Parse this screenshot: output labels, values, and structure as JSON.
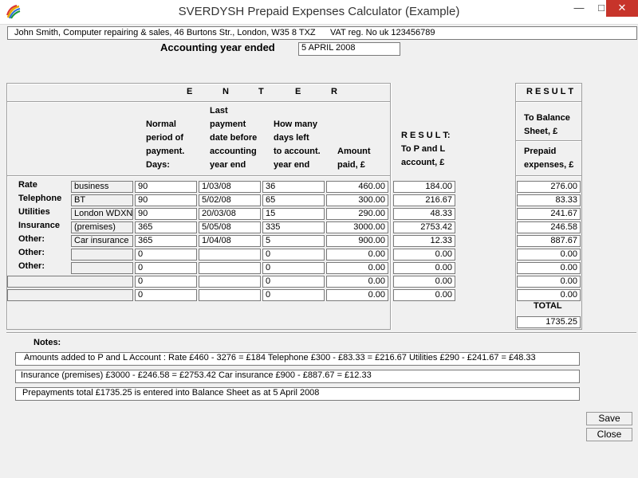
{
  "window": {
    "title": "SVERDYSH Prepaid Expenses Calculator (Example)",
    "minimize": "—",
    "maximize": "□",
    "close": "✕"
  },
  "company": {
    "line": "John Smith, Computer repairing & sales, 46 Burtons Str., London, W35 8 TXZ",
    "vat": "VAT reg. No uk 123456789"
  },
  "accounting": {
    "label": "Accounting year ended",
    "value": "5 APRIL 2008"
  },
  "enter_header": [
    "E",
    "N",
    "T",
    "E",
    "R"
  ],
  "columns": {
    "normal": [
      "Normal",
      "period of",
      "payment.",
      "Days:"
    ],
    "last": [
      "Last",
      "payment",
      "date before",
      "accounting",
      "year end"
    ],
    "howmany": [
      "How many",
      "days left",
      "to account.",
      "year end"
    ],
    "amount": [
      "Amount",
      "paid, £"
    ],
    "pl": [
      "R E S U L T:",
      "To P and L",
      "account, £"
    ]
  },
  "result_panel": {
    "title": "R E S U L T",
    "balance": [
      "To Balance",
      "Sheet, £"
    ],
    "prepaid": [
      "Prepaid",
      "expenses, £"
    ],
    "total_label": "TOTAL",
    "total_value": "1735.25"
  },
  "rows": [
    {
      "label": "Rate",
      "desc": "business",
      "days": "90",
      "date": "1/03/08",
      "left": "36",
      "amount": "460.00",
      "pl": "184.00",
      "bs": "276.00"
    },
    {
      "label": "Telephone",
      "desc": "BT",
      "days": "90",
      "date": "5/02/08",
      "left": "65",
      "amount": "300.00",
      "pl": "216.67",
      "bs": "83.33"
    },
    {
      "label": "Utilities",
      "desc": "London WDXN",
      "days": "90",
      "date": "20/03/08",
      "left": "15",
      "amount": "290.00",
      "pl": "48.33",
      "bs": "241.67"
    },
    {
      "label": "Insurance",
      "desc": "(premises)",
      "days": "365",
      "date": "5/05/08",
      "left": "335",
      "amount": "3000.00",
      "pl": "2753.42",
      "bs": "246.58"
    },
    {
      "label": "Other:",
      "desc": "Car insurance",
      "days": "365",
      "date": "1/04/08",
      "left": "5",
      "amount": "900.00",
      "pl": "12.33",
      "bs": "887.67"
    },
    {
      "label": "Other:",
      "desc": "",
      "days": "0",
      "date": "",
      "left": "0",
      "amount": "0.00",
      "pl": "0.00",
      "bs": "0.00"
    },
    {
      "label": "Other:",
      "desc": "",
      "days": "0",
      "date": "",
      "left": "0",
      "amount": "0.00",
      "pl": "0.00",
      "bs": "0.00"
    },
    {
      "label": "",
      "desc": "",
      "days": "0",
      "date": "",
      "left": "0",
      "amount": "0.00",
      "pl": "0.00",
      "bs": "0.00"
    },
    {
      "label": "",
      "desc": "",
      "days": "0",
      "date": "",
      "left": "0",
      "amount": "0.00",
      "pl": "0.00",
      "bs": "0.00"
    }
  ],
  "notes": {
    "label": "Notes:",
    "line1": "Amounts added to P and L Account :        Rate £460 - 3276 = £184      Telephone £300 - £83.33 = £216.67      Utilities £290 - £241.67 = £48.33",
    "line2": "Insurance (premises)    £3000 - £246.58 = £2753.42       Car insurance  £900 - £887.67 = £12.33",
    "line3": "Prepayments total £1735.25 is entered into Balance Sheet as at 5 April 2008"
  },
  "buttons": {
    "save": "Save",
    "close": "Close"
  }
}
